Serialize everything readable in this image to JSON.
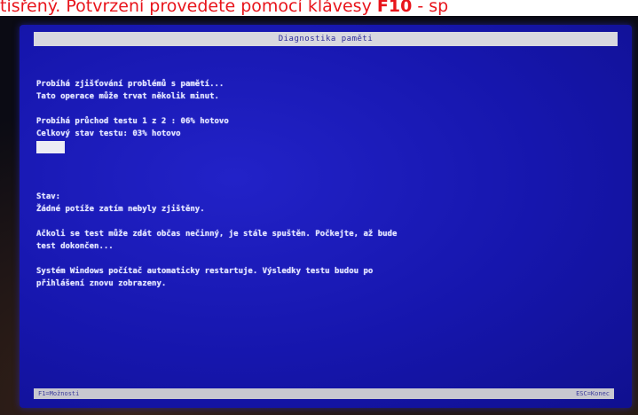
{
  "caption": {
    "text_before": "tisřený. Potvrzení provedete pomocí klávesy ",
    "key": "F10",
    "text_after": " - sp"
  },
  "screen": {
    "title": "Diagnostika paměti",
    "status_lines": [
      "Probíhá zjišťování problémů s pamětí...",
      "Tato operace může trvat několik minut."
    ],
    "pass_line": "Probíhá průchod testu 1 z 2 : 06% hotovo",
    "overall_line": "Celkový stav testu: 03% hotovo",
    "state_label": "Stav:",
    "state_value": "Žádné potíže zatím nebyly zjištěny.",
    "note_lines": [
      "Ačkoli se test může zdát občas nečinný, je stále spuštěn. Počkejte, až bude",
      "test dokončen..."
    ],
    "restart_lines": [
      "Systém Windows počítač automaticky restartuje. Výsledky testu budou po",
      "přihlášení znovu zobrazeny."
    ],
    "footer_left": "F1=Možnosti",
    "footer_right": "ESC=Konec"
  },
  "colors": {
    "caption": "#e8141b",
    "screen_bg": "#1717b4",
    "text": "#e4e6ff",
    "bar": "#d8d8df"
  }
}
